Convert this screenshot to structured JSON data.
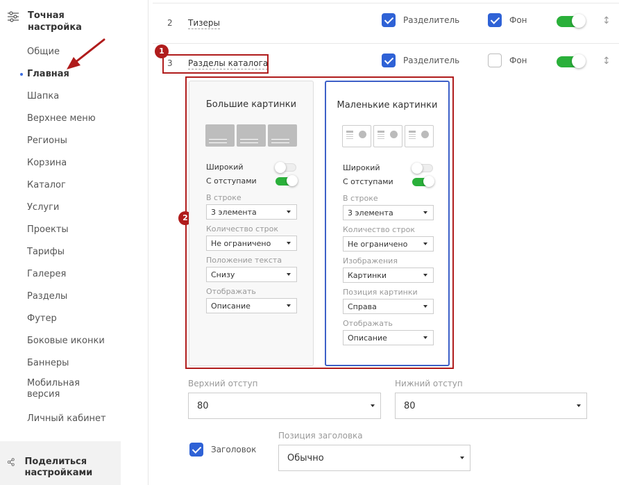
{
  "sidebar": {
    "header": "Точная настройка",
    "items": [
      {
        "label": "Общие",
        "active": false
      },
      {
        "label": "Главная",
        "active": true
      },
      {
        "label": "Шапка",
        "active": false
      },
      {
        "label": "Верхнее меню",
        "active": false
      },
      {
        "label": "Регионы",
        "active": false
      },
      {
        "label": "Корзина",
        "active": false
      },
      {
        "label": "Каталог",
        "active": false
      },
      {
        "label": "Услуги",
        "active": false
      },
      {
        "label": "Проекты",
        "active": false
      },
      {
        "label": "Тарифы",
        "active": false
      },
      {
        "label": "Галерея",
        "active": false
      },
      {
        "label": "Разделы",
        "active": false
      },
      {
        "label": "Футер",
        "active": false
      },
      {
        "label": "Боковые иконки",
        "active": false
      },
      {
        "label": "Баннеры",
        "active": false
      },
      {
        "label": "Мобильная версия",
        "active": false
      },
      {
        "label": "Личный кабинет",
        "active": false
      }
    ],
    "footer": "Поделиться настройками"
  },
  "rows": [
    {
      "num": "2",
      "name": "Тизеры",
      "divider_label": "Разделитель",
      "divider_checked": true,
      "bg_label": "Фон",
      "bg_checked": true,
      "enabled": true
    },
    {
      "num": "3",
      "name": "Разделы каталога",
      "divider_label": "Разделитель",
      "divider_checked": true,
      "bg_label": "Фон",
      "bg_checked": false,
      "enabled": true
    }
  ],
  "badges": {
    "one": "1",
    "two": "2"
  },
  "cards": {
    "big": {
      "title": "Большие картинки",
      "wide_label": "Широкий",
      "wide_on": false,
      "padding_label": "С отступами",
      "padding_on": true,
      "f1_label": "В строке",
      "f1_value": "3 элемента",
      "f2_label": "Количество строк",
      "f2_value": "Не ограничено",
      "f3_label": "Положение текста",
      "f3_value": "Снизу",
      "f4_label": "Отображать",
      "f4_value": "Описание"
    },
    "small": {
      "title": "Маленькие картинки",
      "wide_label": "Широкий",
      "wide_on": false,
      "padding_label": "С отступами",
      "padding_on": true,
      "f1_label": "В строке",
      "f1_value": "3 элемента",
      "f2_label": "Количество строк",
      "f2_value": "Не ограничено",
      "f3_label": "Изображения",
      "f3_value": "Картинки",
      "f4_label": "Позиция картинки",
      "f4_value": "Справа",
      "f5_label": "Отображать",
      "f5_value": "Описание"
    }
  },
  "spacing": {
    "top_label": "Верхний отступ",
    "top_value": "80",
    "bottom_label": "Нижний отступ",
    "bottom_value": "80"
  },
  "heading": {
    "checkbox_label": "Заголовок",
    "checked": true,
    "position_label": "Позиция заголовка",
    "position_value": "Обычно"
  },
  "colors": {
    "accent": "#2f62d6",
    "toggle_on": "#2ab03a",
    "annotation": "#b01c1c"
  }
}
